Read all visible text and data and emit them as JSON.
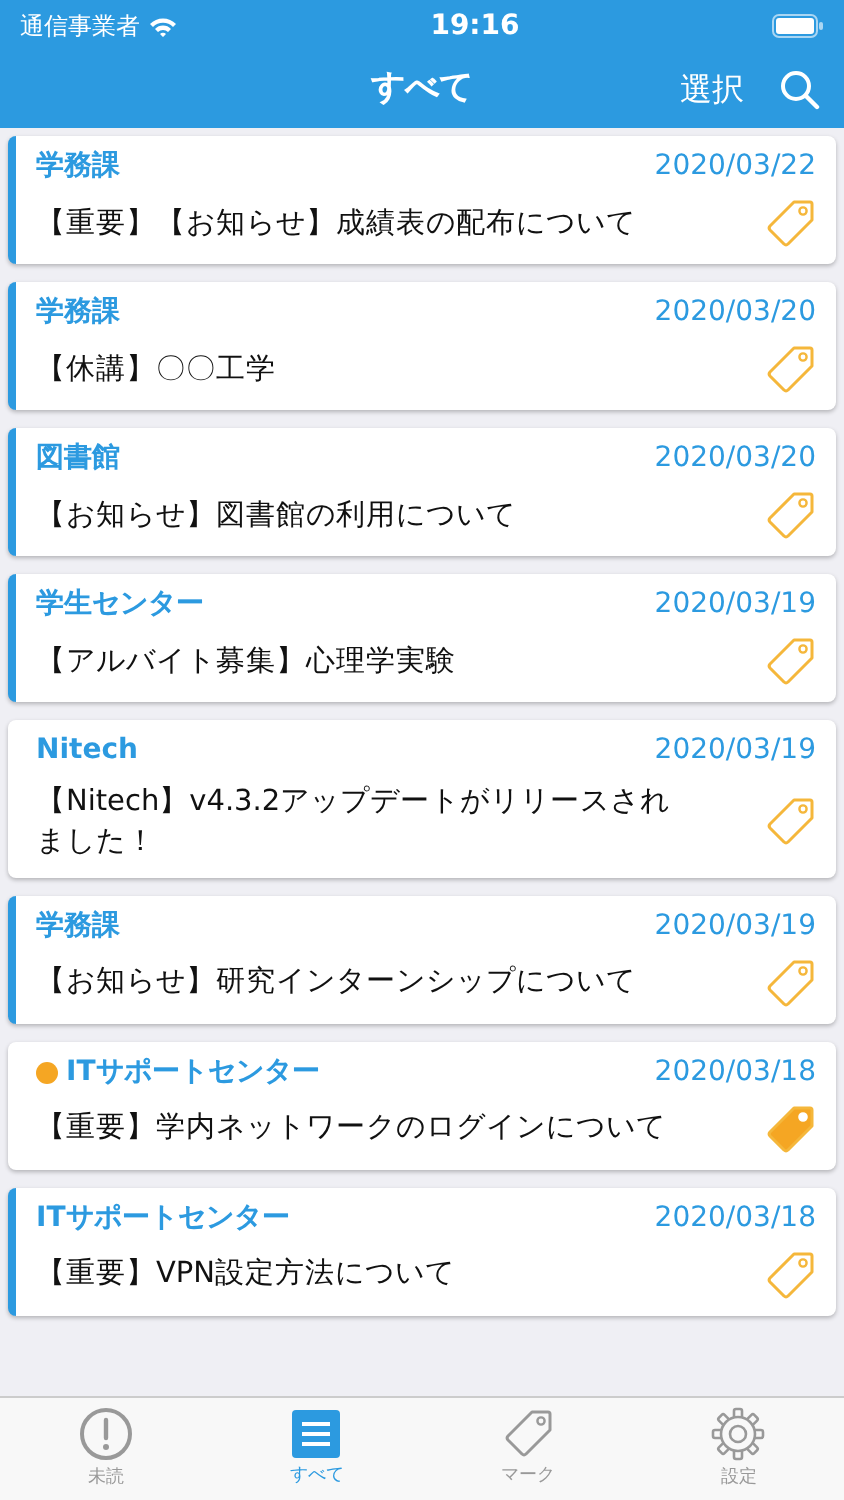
{
  "status_bar": {
    "carrier": "通信事業者",
    "time": "19:16"
  },
  "nav": {
    "title": "すべて",
    "select": "選択"
  },
  "items": [
    {
      "source": "学務課",
      "date": "2020/03/22",
      "title": "【重要】【お知らせ】成績表の配布について",
      "unread": true,
      "dot": false,
      "marked": false
    },
    {
      "source": "学務課",
      "date": "2020/03/20",
      "title": "【休講】〇〇工学",
      "unread": true,
      "dot": false,
      "marked": false
    },
    {
      "source": "図書館",
      "date": "2020/03/20",
      "title": "【お知らせ】図書館の利用について",
      "unread": true,
      "dot": false,
      "marked": false
    },
    {
      "source": "学生センター",
      "date": "2020/03/19",
      "title": "【アルバイト募集】心理学実験",
      "unread": true,
      "dot": false,
      "marked": false
    },
    {
      "source": "Nitech",
      "date": "2020/03/19",
      "title": "【Nitech】v4.3.2アップデートがリリースされました！",
      "unread": false,
      "dot": false,
      "marked": false
    },
    {
      "source": "学務課",
      "date": "2020/03/19",
      "title": "【お知らせ】研究インターンシップについて",
      "unread": true,
      "dot": false,
      "marked": false
    },
    {
      "source": "ITサポートセンター",
      "date": "2020/03/18",
      "title": "【重要】学内ネットワークのログインについて",
      "unread": false,
      "dot": true,
      "marked": true
    },
    {
      "source": "ITサポートセンター",
      "date": "2020/03/18",
      "title": "【重要】VPN設定方法について",
      "unread": true,
      "dot": false,
      "marked": false
    }
  ],
  "tabs": [
    {
      "kind": "unread",
      "label": "未読",
      "selected": false
    },
    {
      "kind": "all",
      "label": "すべて",
      "selected": true
    },
    {
      "kind": "mark",
      "label": "マーク",
      "selected": false
    },
    {
      "kind": "settings",
      "label": "設定",
      "selected": false
    }
  ]
}
